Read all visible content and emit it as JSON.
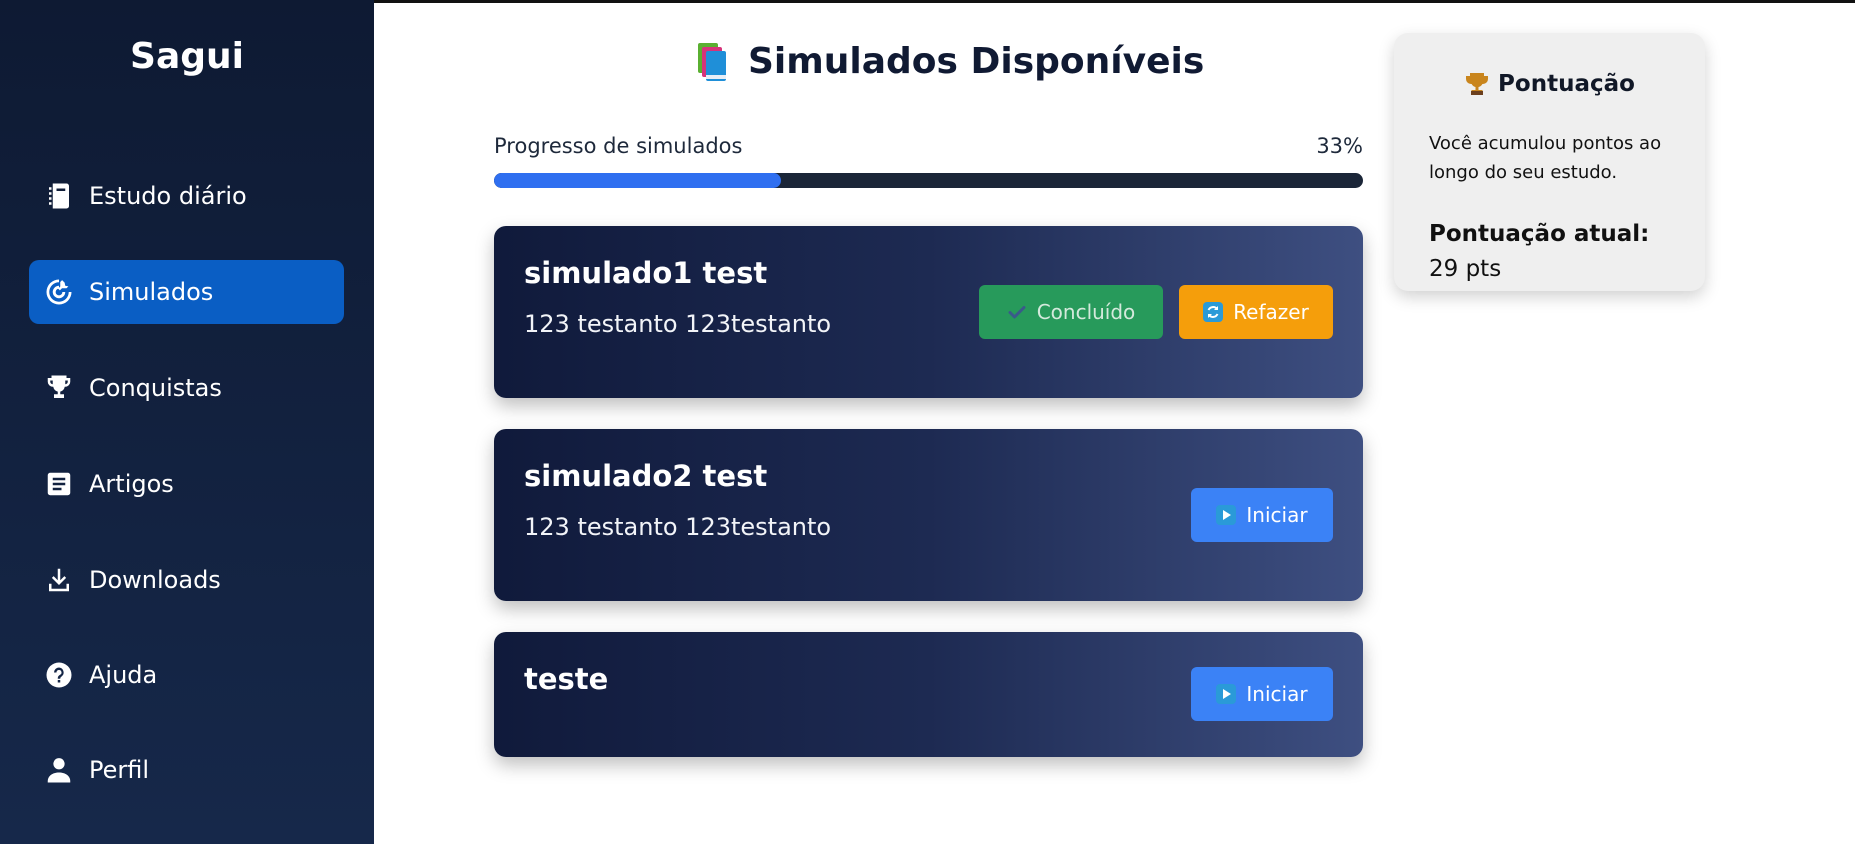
{
  "app": {
    "brand": "Sagui"
  },
  "sidebar": {
    "items": [
      {
        "label": "Estudo diário",
        "icon": "notebook-icon",
        "active": false
      },
      {
        "label": "Simulados",
        "icon": "target-icon",
        "active": true
      },
      {
        "label": "Conquistas",
        "icon": "trophy-icon",
        "active": false
      },
      {
        "label": "Artigos",
        "icon": "article-icon",
        "active": false
      },
      {
        "label": "Downloads",
        "icon": "download-icon",
        "active": false
      },
      {
        "label": "Ajuda",
        "icon": "help-icon",
        "active": false
      },
      {
        "label": "Perfil",
        "icon": "user-icon",
        "active": false
      }
    ]
  },
  "main": {
    "title": "Simulados Disponíveis",
    "title_icon": "books-icon",
    "progress": {
      "label": "Progresso de simulados",
      "percent_text": "33%",
      "value": 33
    },
    "simulados": [
      {
        "title": "simulado1 test",
        "description": "123 testanto 123testanto",
        "done_label": "Concluído",
        "redo_label": "Refazer"
      },
      {
        "title": "simulado2 test",
        "description": "123 testanto 123testanto",
        "start_label": "Iniciar"
      },
      {
        "title": "teste",
        "description": "",
        "start_label": "Iniciar"
      }
    ]
  },
  "score": {
    "title": "Pontuação",
    "title_icon": "trophy-icon",
    "description": "Você acumulou pontos ao longo do seu estudo.",
    "current_label": "Pontuação atual:",
    "current_value": "29 pts"
  },
  "colors": {
    "sidebar_active": "#0a5ec4",
    "done_button": "#279a5b",
    "redo_button": "#f59e0b",
    "start_button": "#3b82f6",
    "progress_fill": "#2f6ff0"
  }
}
